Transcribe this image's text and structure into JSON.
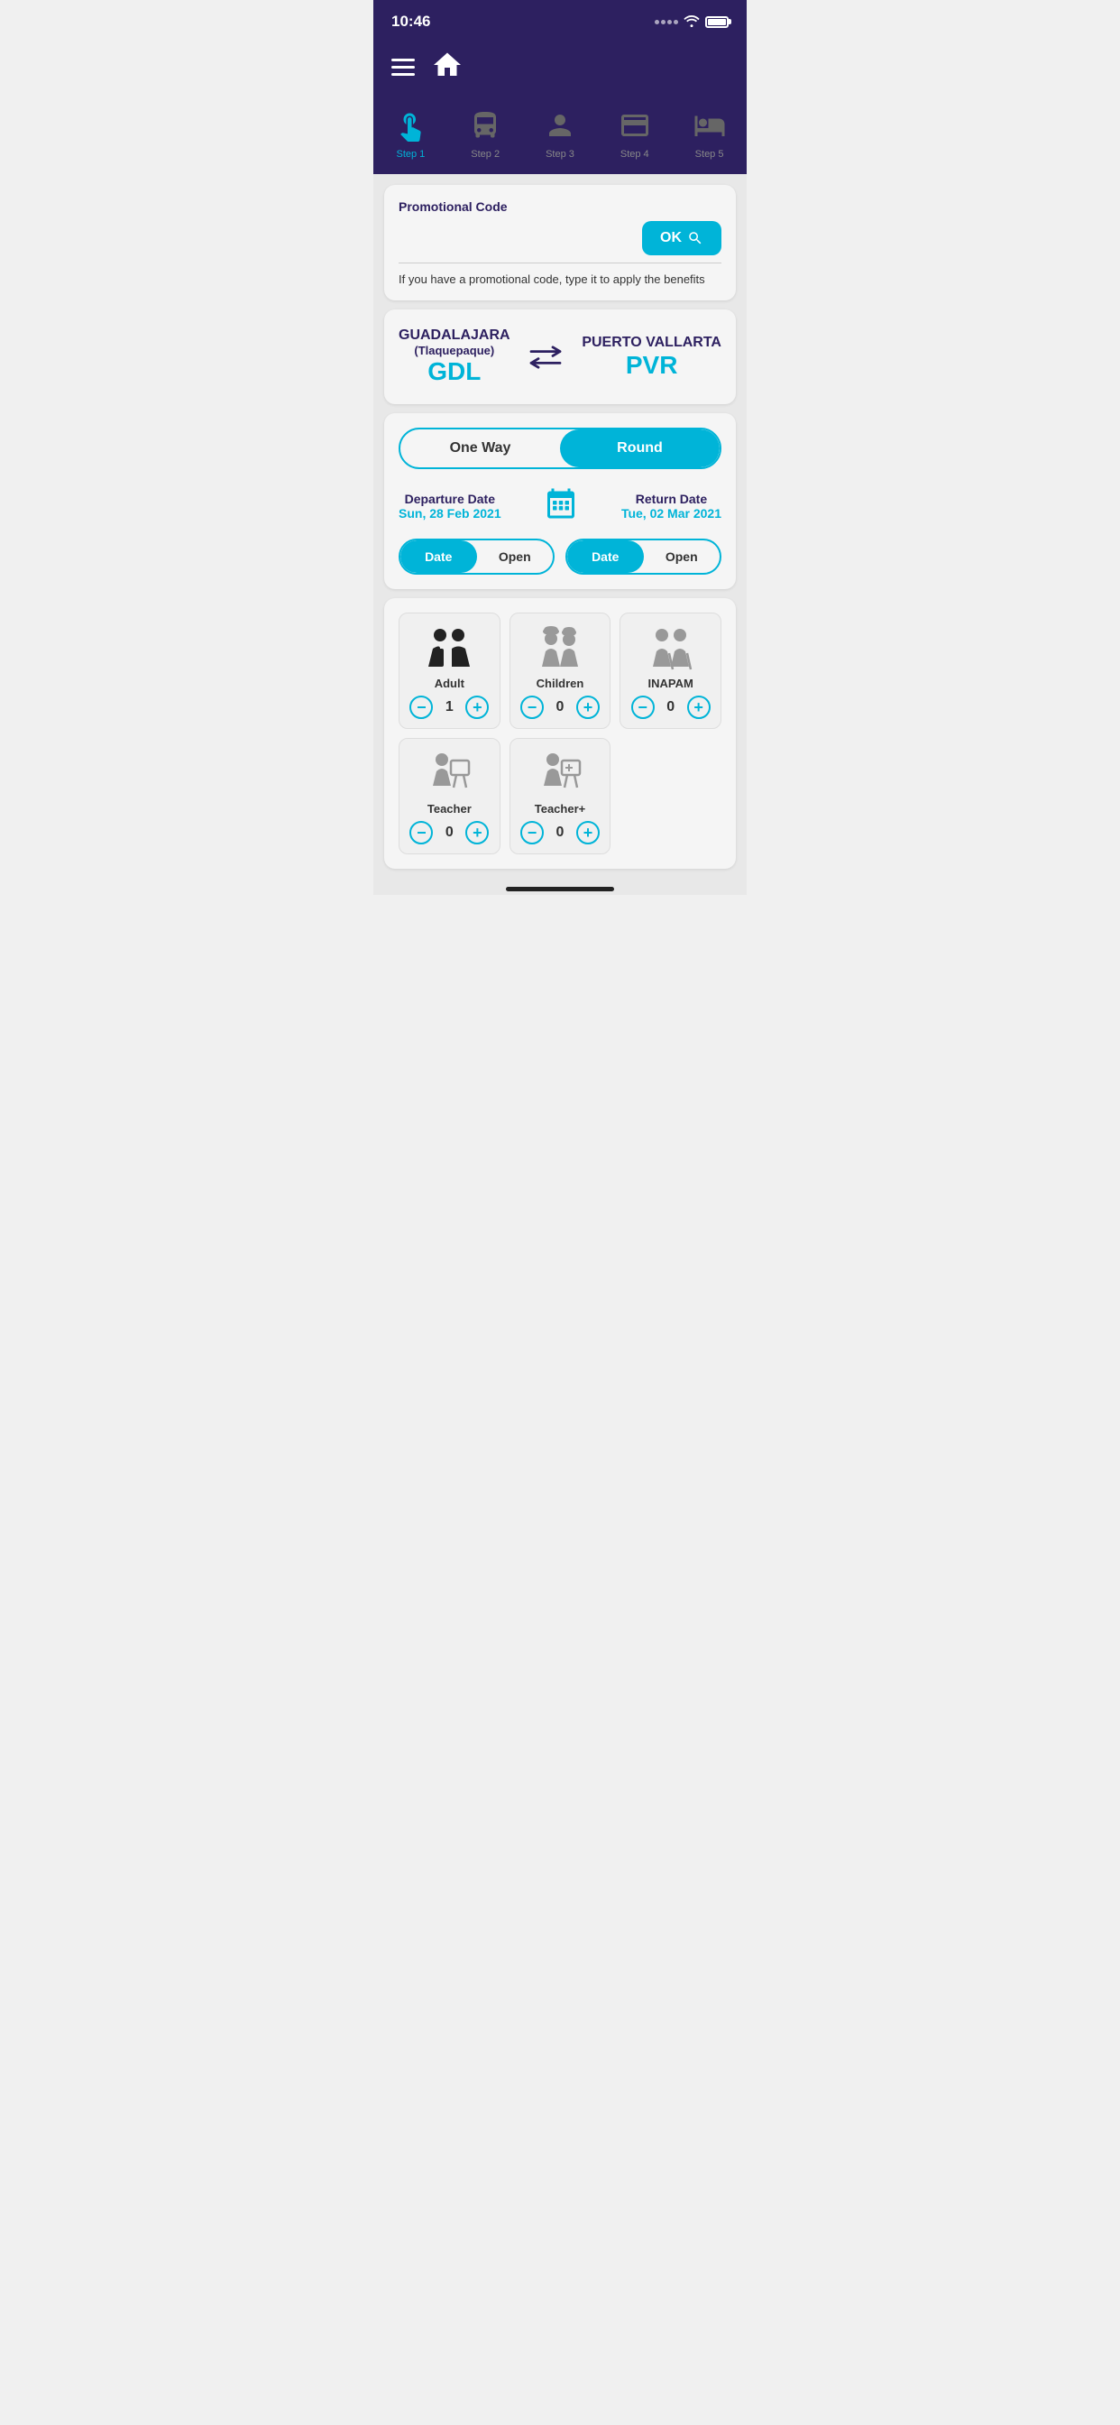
{
  "statusBar": {
    "time": "10:46"
  },
  "header": {
    "hamburgerLabel": "Menu",
    "homeLabel": "Home"
  },
  "steps": [
    {
      "id": "step1",
      "label": "Step 1",
      "active": true,
      "icon": "touch"
    },
    {
      "id": "step2",
      "label": "Step 2",
      "active": false,
      "icon": "bus"
    },
    {
      "id": "step3",
      "label": "Step 3",
      "active": false,
      "icon": "person"
    },
    {
      "id": "step4",
      "label": "Step 4",
      "active": false,
      "icon": "payment"
    },
    {
      "id": "step5",
      "label": "Step 5",
      "active": false,
      "icon": "seat"
    }
  ],
  "promoCode": {
    "label": "Promotional Code",
    "placeholder": "",
    "okButton": "OK",
    "hint": "If you have a promotional code, type it to apply the benefits"
  },
  "route": {
    "originName": "GUADALAJARA",
    "originSub": "(Tlaquepaque)",
    "originCode": "GDL",
    "destName": "PUERTO VALLARTA",
    "destCode": "PVR"
  },
  "tripType": {
    "oneWayLabel": "One Way",
    "roundLabel": "Round",
    "selected": "round"
  },
  "dates": {
    "departureDateLabel": "Departure Date",
    "departureDate": "Sun, 28 Feb 2021",
    "returnDateLabel": "Return Date",
    "returnDate": "Tue, 02 Mar 2021",
    "departureDateBtn": "Date",
    "departureOpenBtn": "Open",
    "returnDateBtn": "Date",
    "returnOpenBtn": "Open"
  },
  "passengers": {
    "adult": {
      "name": "Adult",
      "count": 1
    },
    "children": {
      "name": "Children",
      "count": 0
    },
    "inapam": {
      "name": "INAPAM",
      "count": 0
    },
    "teacher": {
      "name": "Teacher",
      "count": 0
    },
    "teacherPlus": {
      "name": "Teacher+",
      "count": 0
    }
  },
  "colors": {
    "primary": "#2d2060",
    "accent": "#00b4d8"
  }
}
